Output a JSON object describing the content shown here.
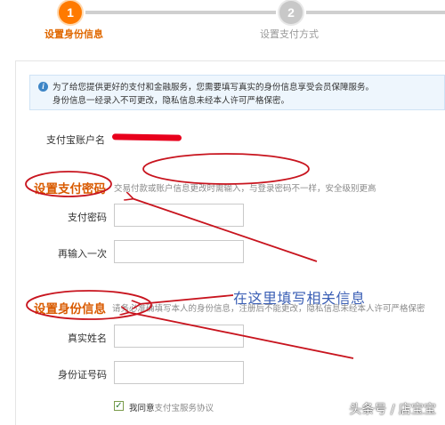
{
  "steps": [
    {
      "number": "1",
      "label": "设置身份信息",
      "active": true
    },
    {
      "number": "2",
      "label": "设置支付方式",
      "active": false
    }
  ],
  "notice": {
    "line1": "为了给您提供更好的支付和金融服务，您需要填写真实的身份信息享受会员保障服务。",
    "line2": "身份信息一经录入不可更改，隐私信息未经本人许可严格保密。"
  },
  "account": {
    "label": "支付宝账户名"
  },
  "payment_section": {
    "title": "设置支付密码",
    "description": "交易付款或账户信息更改时需输入，与登录密码不一样，安全级别更高",
    "fields": [
      {
        "label": "支付密码",
        "value": ""
      },
      {
        "label": "再输入一次",
        "value": ""
      }
    ]
  },
  "identity_section": {
    "title": "设置身份信息",
    "description": "请务必准确填写本人的身份信息，注册后不能更改，隐私信息未经本人许可严格保密",
    "fields": [
      {
        "label": "真实姓名",
        "value": ""
      },
      {
        "label": "身份证号码",
        "value": ""
      }
    ]
  },
  "agreement": {
    "prefix": "我同意",
    "link": "支付宝服务协议",
    "checked": true
  },
  "annotation": "在这里填写相关信息",
  "watermark": "头条号 / 店宝宝",
  "colors": {
    "accent": "#d95a00",
    "step_active": "#ff7a00",
    "annotation": "#3b5fb5",
    "markup_red": "#c8141e"
  }
}
